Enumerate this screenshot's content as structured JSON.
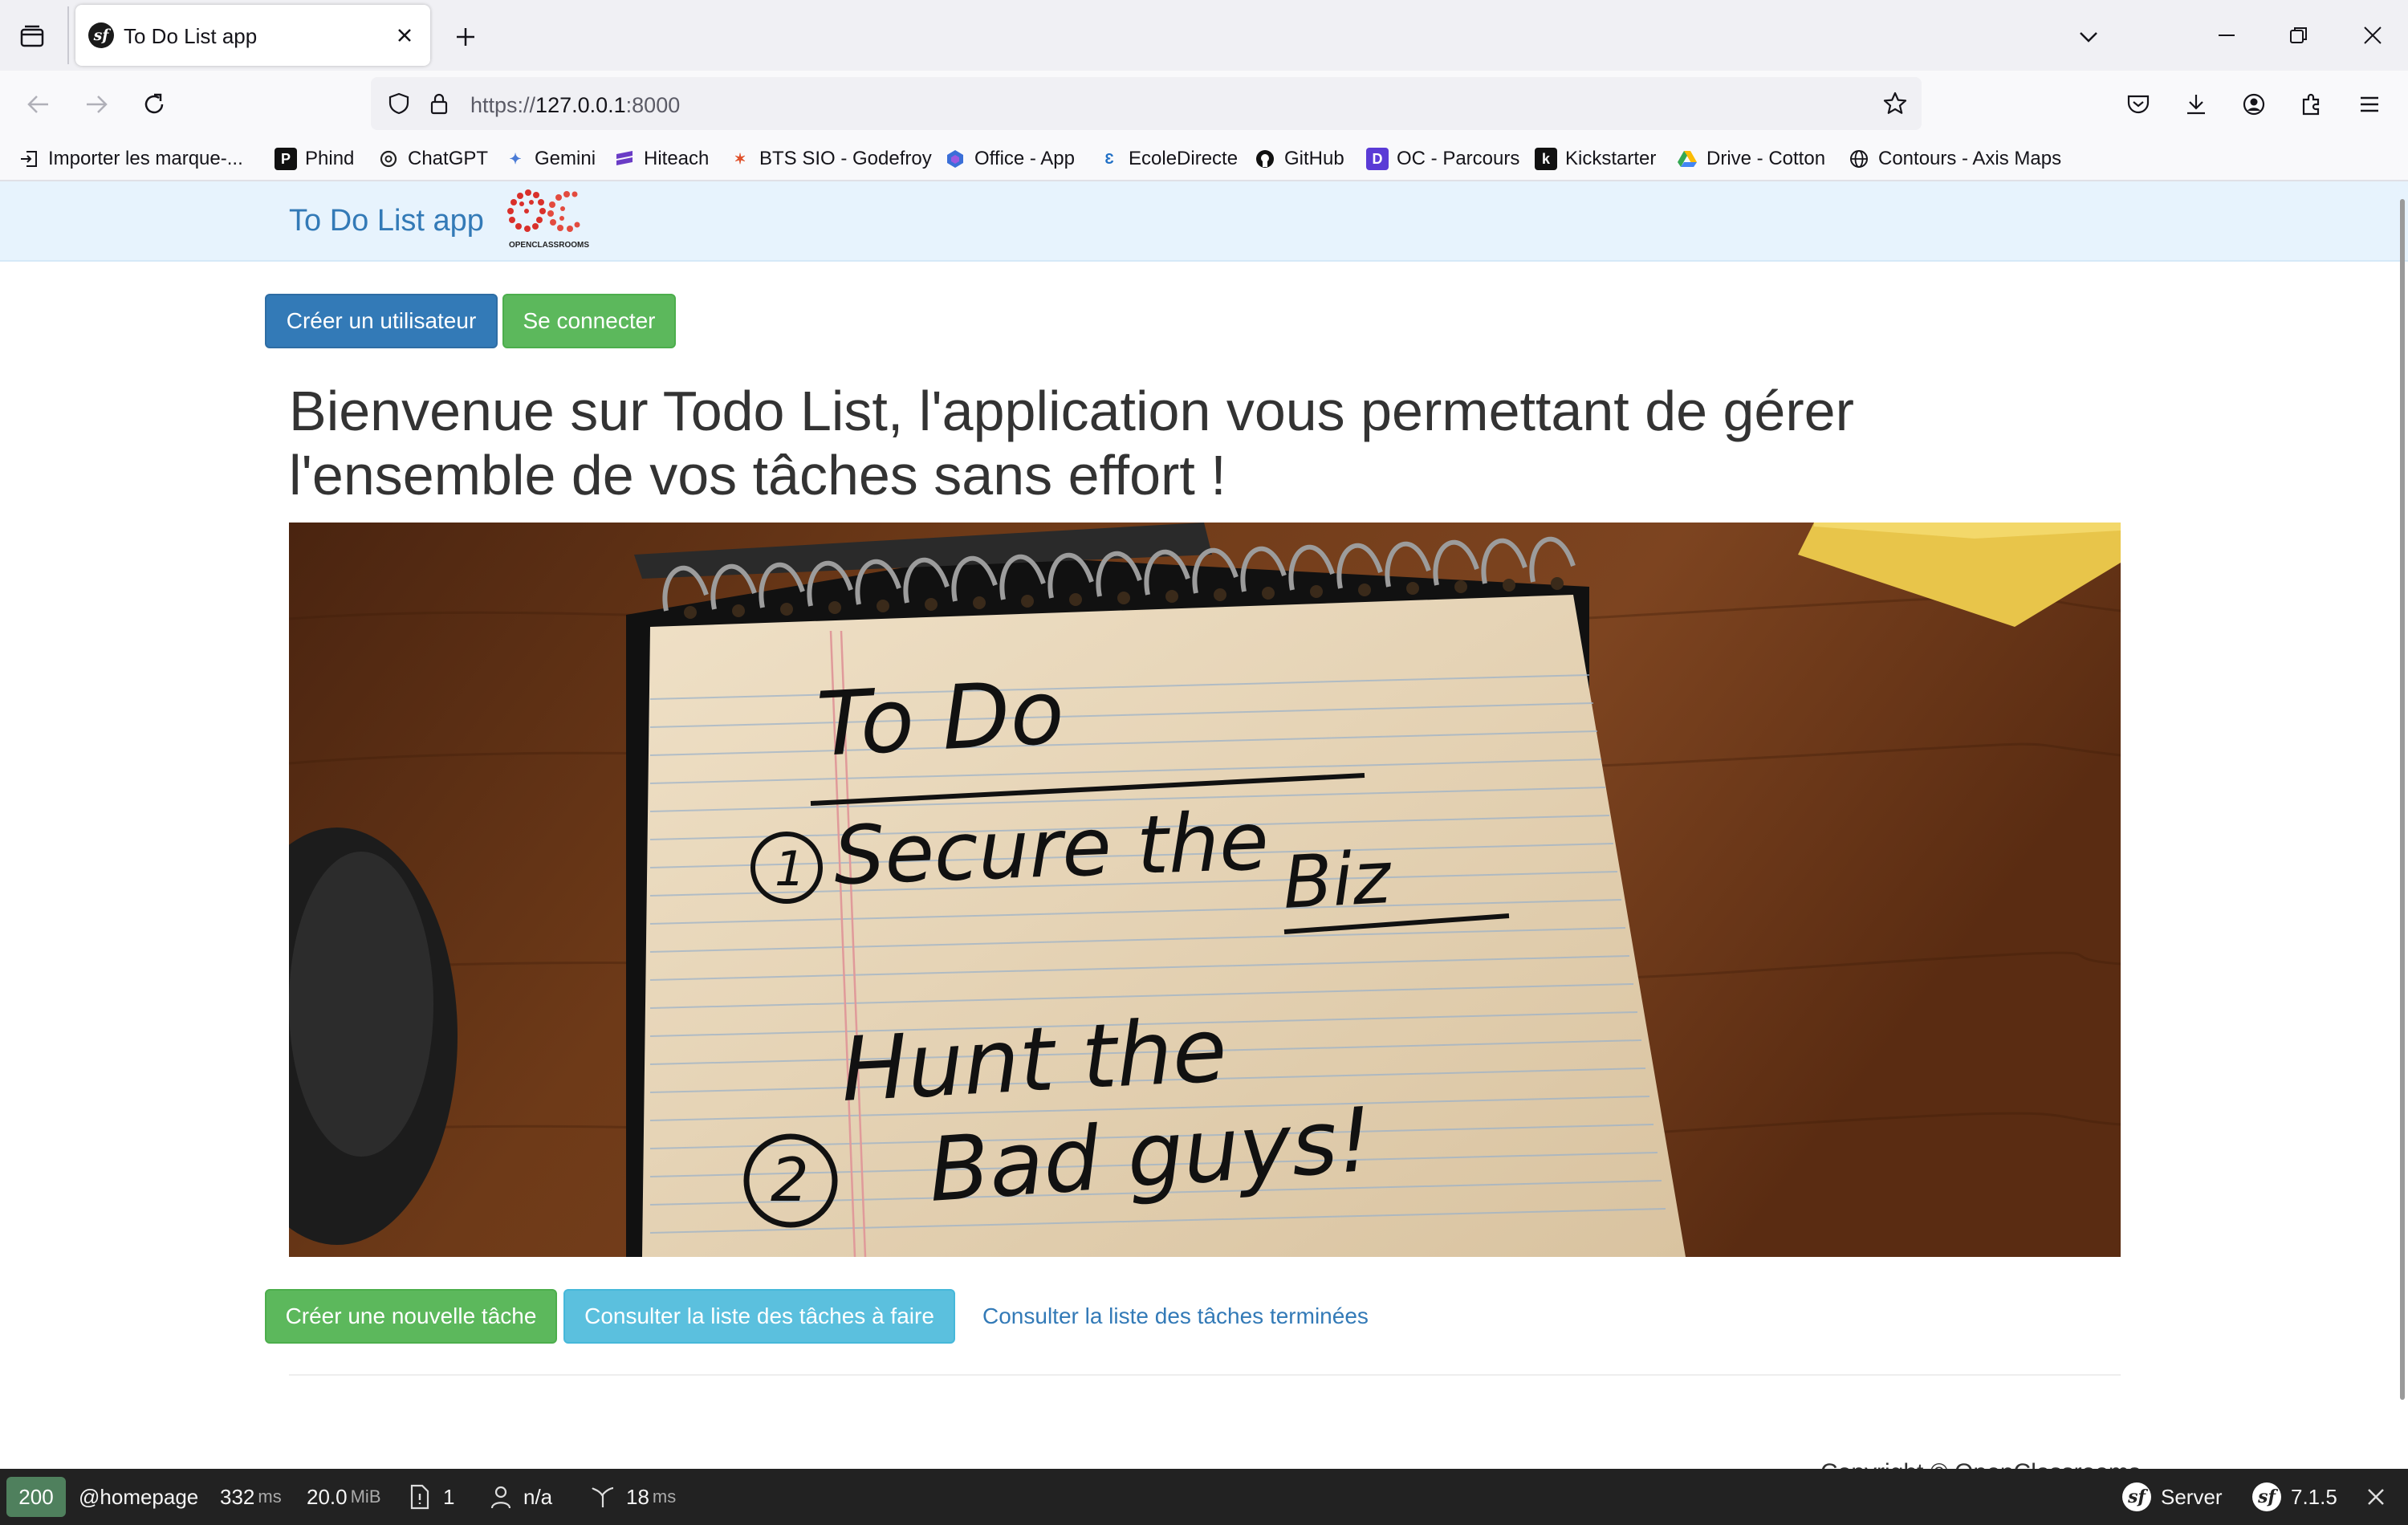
{
  "browser": {
    "tab": {
      "title": "To Do List app"
    },
    "url": {
      "scheme": "https://",
      "host": "127.0.0.1",
      "port": ":8000"
    },
    "bookmarks": [
      {
        "label": "Importer les marque-...",
        "icon": "import-icon"
      },
      {
        "label": "Phind",
        "icon": "phind-icon"
      },
      {
        "label": "ChatGPT",
        "icon": "chatgpt-icon"
      },
      {
        "label": "Gemini",
        "icon": "gemini-icon"
      },
      {
        "label": "Hiteach",
        "icon": "hiteach-icon"
      },
      {
        "label": "BTS SIO - Godefroy",
        "icon": "bts-icon"
      },
      {
        "label": "Office - App",
        "icon": "office-icon"
      },
      {
        "label": "EcoleDirecte",
        "icon": "ecoledirecte-icon"
      },
      {
        "label": "GitHub",
        "icon": "github-icon"
      },
      {
        "label": "OC - Parcours",
        "icon": "openclassrooms-icon"
      },
      {
        "label": "Kickstarter",
        "icon": "kickstarter-icon"
      },
      {
        "label": "Drive - Cotton",
        "icon": "google-drive-icon"
      },
      {
        "label": "Contours - Axis Maps",
        "icon": "globe-icon"
      }
    ]
  },
  "site": {
    "brand": "To Do List app",
    "logo_text": "OPENCLASSROOMS",
    "buttons": {
      "create_user": "Créer un utilisateur",
      "login": "Se connecter",
      "new_task": "Créer une nouvelle tâche",
      "todo_list": "Consulter la liste des tâches à faire",
      "done_list": "Consulter la liste des tâches terminées"
    },
    "welcome_line1": "Bienvenue sur Todo List, l'application vous permettant de gérer",
    "welcome_line2": "l'ensemble de vos tâches sans effort !",
    "hero_image": {
      "line1": "To Do",
      "item1_a": "Secure the",
      "item1_b": "Biz",
      "item2_a": "Hunt the",
      "item2_b": "Bad guys!",
      "num1": "1",
      "num2": "2"
    },
    "footer": "Copyright © OpenClassrooms"
  },
  "symfony_toolbar": {
    "status_code": "200",
    "route": "@homepage",
    "time_value": "332",
    "time_unit": "ms",
    "memory_value": "20.0",
    "memory_unit": "MiB",
    "logs_count": "1",
    "user": "n/a",
    "twig_value": "18",
    "twig_unit": "ms",
    "server_label": "Server",
    "version": "7.1.5"
  },
  "colors": {
    "primary": "#337ab7",
    "success": "#5cb85c",
    "info": "#5bc0de",
    "navbar_bg": "#e7f3fd",
    "toolbar_bg": "#222222",
    "status_ok": "#4f805d"
  }
}
